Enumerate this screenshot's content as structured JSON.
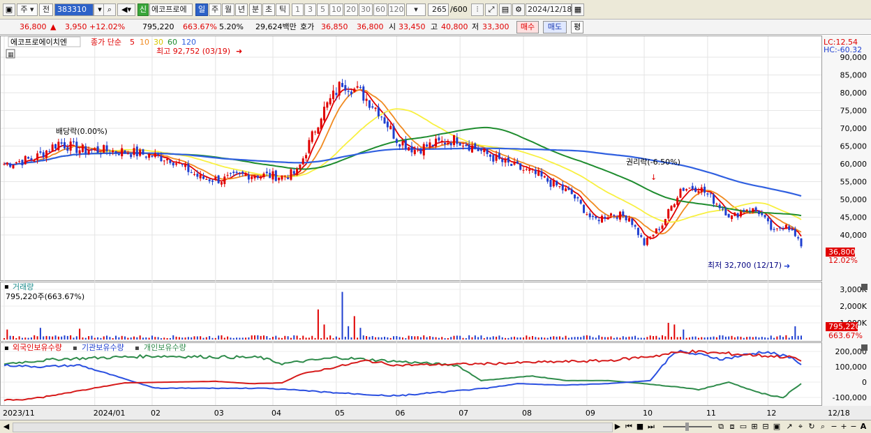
{
  "toolbar": {
    "type_select": "주",
    "prev_label": "전",
    "code_value": "383310",
    "badge_new": "신",
    "stock_name": "에코프로에",
    "periods": [
      "일",
      "주",
      "월",
      "년",
      "분",
      "초",
      "틱"
    ],
    "active_period": "일",
    "nums": [
      "1",
      "3",
      "5",
      "10",
      "20",
      "30",
      "60",
      "120"
    ],
    "count_value": "265",
    "count_total": "/600",
    "date_value": "2024/12/18"
  },
  "quote": {
    "price": "36,800",
    "change": "3,950",
    "change_pct": "+12.02%",
    "volume": "795,220",
    "volume_pct": "663.67%",
    "turnover_pct": "5.20%",
    "amount": "29,624백만",
    "ask_label": "호가",
    "ask": "36,850",
    "bid": "36,800",
    "open_label": "시",
    "open": "33,450",
    "high_label": "고",
    "high": "40,800",
    "low_label": "저",
    "low": "33,300",
    "buy_label": "매수",
    "sell_label": "매도",
    "flat_label": "평"
  },
  "price_panel": {
    "stock_label": "에코프로에이치엔",
    "ma_label": "종가 단순",
    "ma_periods": [
      "5",
      "10",
      "30",
      "60",
      "120"
    ],
    "lc_label": "LC:12.54",
    "hc_label": "HC:-60.32",
    "y_ticks": [
      "90,000",
      "85,000",
      "80,000",
      "75,000",
      "70,000",
      "65,000",
      "60,000",
      "55,000",
      "50,000",
      "45,000",
      "40,000"
    ],
    "max_note": "최고 92,752 (03/19)",
    "min_note": "최저 32,700 (12/17)",
    "dividend_note": "배당락(0.00%)",
    "rights_note": "권리락(-6.50%)",
    "last_price_tag": "36,800",
    "last_pct_tag": "12.02%"
  },
  "volume_panel": {
    "title": "거래량",
    "value_line": "795,220주(663.67%)",
    "y_ticks": [
      "3,000K",
      "2,000K",
      "1,000K"
    ],
    "last_tag": "795,220",
    "last_pct_tag": "663.67%"
  },
  "holdings_panel": {
    "series_labels": [
      "외국인보유수량",
      "기관보유수량",
      "개인보유수량"
    ],
    "y_ticks": [
      "200,000",
      "100,000",
      "0",
      "-100,000"
    ]
  },
  "x_axis": {
    "labels": [
      "2023/11",
      "2024/01",
      "02",
      "03",
      "04",
      "05",
      "06",
      "07",
      "08",
      "09",
      "10",
      "11",
      "12"
    ],
    "end_label": "12/18"
  },
  "colors": {
    "up": "#e00000",
    "down": "#1f3fd0",
    "ma5": "#e00000",
    "ma10": "#f08a20",
    "ma30": "#f8f040",
    "ma60": "#1e8c2e",
    "ma120": "#3060e0"
  },
  "chart_data": {
    "type": "line",
    "title": "에코프로에이치엔",
    "x": [
      "2023/11",
      "2024/01",
      "02",
      "03",
      "04",
      "05",
      "06",
      "07",
      "08",
      "09",
      "10",
      "11",
      "12",
      "12/18"
    ],
    "series": [
      {
        "name": "종가",
        "values": [
          60000,
          64000,
          54500,
          57000,
          80000,
          66000,
          62000,
          57000,
          46000,
          40000,
          55000,
          45000,
          40000,
          36800
        ]
      },
      {
        "name": "120",
        "values": [
          70000,
          71000,
          67000,
          62000,
          61500,
          63000,
          63000,
          62000,
          61500,
          60000,
          55000,
          50000,
          47000,
          45000
        ]
      },
      {
        "name": "60",
        "values": [
          67000,
          62000,
          61000,
          60000,
          63000,
          65000,
          67500,
          62000,
          55000,
          48000,
          46500,
          44000,
          43500,
          43000
        ]
      }
    ],
    "ylim": [
      32000,
      93000
    ]
  }
}
